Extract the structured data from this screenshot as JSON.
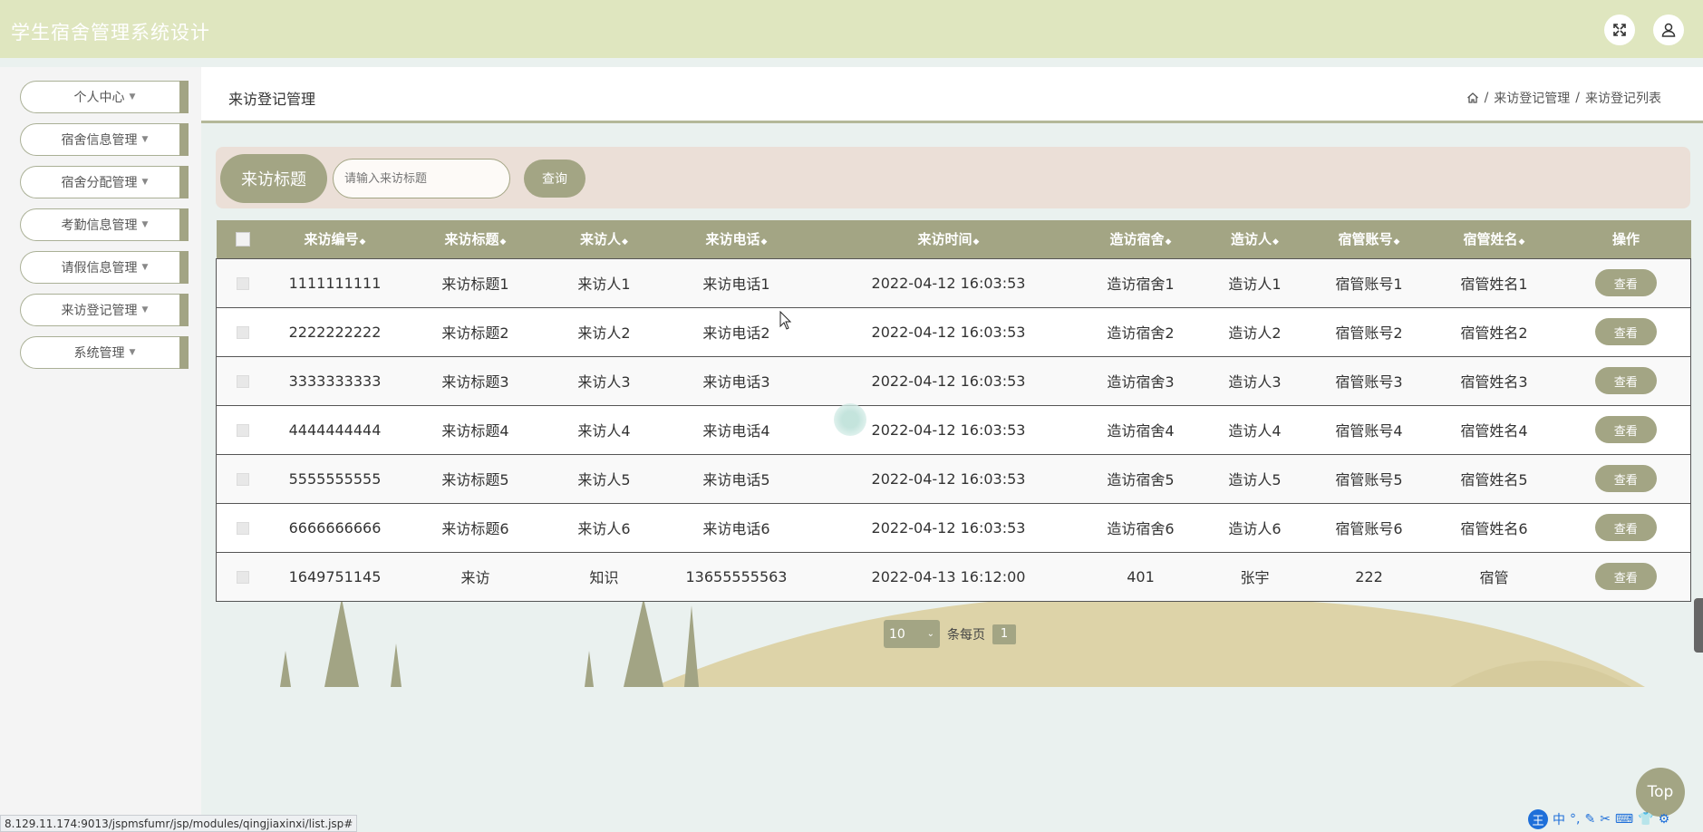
{
  "app": {
    "title": "学生宿舍管理系统设计"
  },
  "header": {
    "expand_icon": "fullscreen-icon",
    "user_icon": "user-icon"
  },
  "sidebar": {
    "items": [
      {
        "label": "个人中心"
      },
      {
        "label": "宿舍信息管理"
      },
      {
        "label": "宿舍分配管理"
      },
      {
        "label": "考勤信息管理"
      },
      {
        "label": "请假信息管理"
      },
      {
        "label": "来访登记管理"
      },
      {
        "label": "系统管理"
      }
    ]
  },
  "page": {
    "title": "来访登记管理",
    "breadcrumb": {
      "level1": "来访登记管理",
      "level2": "来访登记列表",
      "sep": "/"
    }
  },
  "search": {
    "label": "来访标题",
    "placeholder": "请输入来访标题",
    "button": "查询"
  },
  "table": {
    "columns": [
      "来访编号",
      "来访标题",
      "来访人",
      "来访电话",
      "来访时间",
      "造访宿舍",
      "造访人",
      "宿管账号",
      "宿管姓名",
      "操作"
    ],
    "sort_mark": "◆",
    "action_label": "查看",
    "rows": [
      [
        "1111111111",
        "来访标题1",
        "来访人1",
        "来访电话1",
        "2022-04-12 16:03:53",
        "造访宿舍1",
        "造访人1",
        "宿管账号1",
        "宿管姓名1"
      ],
      [
        "2222222222",
        "来访标题2",
        "来访人2",
        "来访电话2",
        "2022-04-12 16:03:53",
        "造访宿舍2",
        "造访人2",
        "宿管账号2",
        "宿管姓名2"
      ],
      [
        "3333333333",
        "来访标题3",
        "来访人3",
        "来访电话3",
        "2022-04-12 16:03:53",
        "造访宿舍3",
        "造访人3",
        "宿管账号3",
        "宿管姓名3"
      ],
      [
        "4444444444",
        "来访标题4",
        "来访人4",
        "来访电话4",
        "2022-04-12 16:03:53",
        "造访宿舍4",
        "造访人4",
        "宿管账号4",
        "宿管姓名4"
      ],
      [
        "5555555555",
        "来访标题5",
        "来访人5",
        "来访电话5",
        "2022-04-12 16:03:53",
        "造访宿舍5",
        "造访人5",
        "宿管账号5",
        "宿管姓名5"
      ],
      [
        "6666666666",
        "来访标题6",
        "来访人6",
        "来访电话6",
        "2022-04-12 16:03:53",
        "造访宿舍6",
        "造访人6",
        "宿管账号6",
        "宿管姓名6"
      ],
      [
        "1649751145",
        "来访",
        "知识",
        "13655555563",
        "2022-04-13 16:12:00",
        "401",
        "张宇",
        "222",
        "宿管"
      ]
    ]
  },
  "pager": {
    "page_size": "10",
    "per_page_label": "条每页",
    "current_page": "1"
  },
  "top_button": "Top",
  "status_url": "8.129.11.174:9013/jspmsfumr/jsp/modules/qingjiaxinxi/list.jsp#",
  "ime": {
    "badge": "王",
    "mode": "中"
  },
  "colors": {
    "accent": "#a3a584",
    "header_bg": "#dfe6bf",
    "search_bg": "#ebdfd7"
  }
}
